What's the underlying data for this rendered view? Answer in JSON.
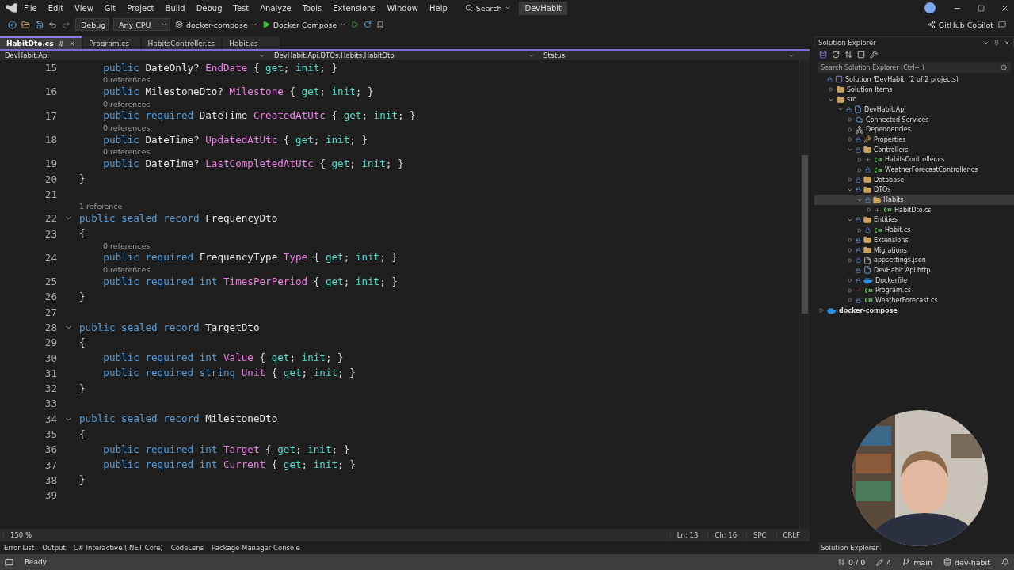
{
  "menu": {
    "items": [
      "File",
      "Edit",
      "View",
      "Git",
      "Project",
      "Build",
      "Debug",
      "Test",
      "Analyze",
      "Tools",
      "Extensions",
      "Window",
      "Help"
    ],
    "search": "Search",
    "solution_name": "DevHabit"
  },
  "toolbar": {
    "configuration": "Debug",
    "platform": "Any CPU",
    "startup_project": "docker-compose",
    "run_target": "Docker Compose"
  },
  "copilot": "GitHub Copilot",
  "tabs": [
    {
      "label": "HabitDto.cs",
      "selected": true
    },
    {
      "label": "Program.cs",
      "selected": false
    },
    {
      "label": "HabitsController.cs",
      "selected": false
    },
    {
      "label": "Habit.cs",
      "selected": false
    }
  ],
  "navbar": {
    "project": "DevHabit.Api",
    "type": "DevHabit.Api.DTOs.Habits.HabitDto",
    "member": "Status"
  },
  "code_lines": [
    {
      "num": "15",
      "tokens": [
        {
          "kind": "kw",
          "t": "    public "
        },
        {
          "kind": "type",
          "t": "DateOnly"
        },
        {
          "kind": "p",
          "t": "? "
        },
        {
          "kind": "prop",
          "t": "EndDate"
        },
        {
          "kind": "p",
          "t": " { "
        },
        {
          "kind": "acc",
          "t": "get"
        },
        {
          "kind": "p",
          "t": "; "
        },
        {
          "kind": "acc",
          "t": "init"
        },
        {
          "kind": "p",
          "t": "; }"
        }
      ]
    },
    {
      "num": "16",
      "lens": "0 references",
      "tokens": [
        {
          "kind": "kw",
          "t": "    public "
        },
        {
          "kind": "type",
          "t": "MilestoneDto"
        },
        {
          "kind": "p",
          "t": "? "
        },
        {
          "kind": "prop",
          "t": "Milestone"
        },
        {
          "kind": "p",
          "t": " { "
        },
        {
          "kind": "acc",
          "t": "get"
        },
        {
          "kind": "p",
          "t": "; "
        },
        {
          "kind": "acc",
          "t": "init"
        },
        {
          "kind": "p",
          "t": "; }"
        }
      ]
    },
    {
      "num": "17",
      "lens": "0 references",
      "tokens": [
        {
          "kind": "kw",
          "t": "    public required "
        },
        {
          "kind": "type",
          "t": "DateTime "
        },
        {
          "kind": "prop",
          "t": "CreatedAtUtc"
        },
        {
          "kind": "p",
          "t": " { "
        },
        {
          "kind": "acc",
          "t": "get"
        },
        {
          "kind": "p",
          "t": "; "
        },
        {
          "kind": "acc",
          "t": "init"
        },
        {
          "kind": "p",
          "t": "; }"
        }
      ]
    },
    {
      "num": "18",
      "lens": "0 references",
      "tokens": [
        {
          "kind": "kw",
          "t": "    public "
        },
        {
          "kind": "type",
          "t": "DateTime"
        },
        {
          "kind": "p",
          "t": "? "
        },
        {
          "kind": "prop",
          "t": "UpdatedAtUtc"
        },
        {
          "kind": "p",
          "t": " { "
        },
        {
          "kind": "acc",
          "t": "get"
        },
        {
          "kind": "p",
          "t": "; "
        },
        {
          "kind": "acc",
          "t": "init"
        },
        {
          "kind": "p",
          "t": "; }"
        }
      ]
    },
    {
      "num": "19",
      "lens": "0 references",
      "tokens": [
        {
          "kind": "kw",
          "t": "    public "
        },
        {
          "kind": "type",
          "t": "DateTime"
        },
        {
          "kind": "p",
          "t": "? "
        },
        {
          "kind": "prop",
          "t": "LastCompletedAtUtc"
        },
        {
          "kind": "p",
          "t": " { "
        },
        {
          "kind": "acc",
          "t": "get"
        },
        {
          "kind": "p",
          "t": "; "
        },
        {
          "kind": "acc",
          "t": "init"
        },
        {
          "kind": "p",
          "t": "; }"
        }
      ]
    },
    {
      "num": "20",
      "tokens": [
        {
          "kind": "p",
          "t": "}"
        }
      ]
    },
    {
      "num": "21"
    },
    {
      "num": "22",
      "lens": "1 reference",
      "fold": {
        "expanded": true
      },
      "tokens": [
        {
          "kind": "kw",
          "t": "public sealed record "
        },
        {
          "kind": "type",
          "t": "FrequencyDto"
        }
      ]
    },
    {
      "num": "23",
      "tokens": [
        {
          "kind": "p",
          "t": "{"
        }
      ]
    },
    {
      "num": "24",
      "lens": "0 references",
      "tokens": [
        {
          "kind": "kw",
          "t": "    public required "
        },
        {
          "kind": "type",
          "t": "FrequencyType "
        },
        {
          "kind": "prop",
          "t": "Type"
        },
        {
          "kind": "p",
          "t": " { "
        },
        {
          "kind": "acc",
          "t": "get"
        },
        {
          "kind": "p",
          "t": "; "
        },
        {
          "kind": "acc",
          "t": "init"
        },
        {
          "kind": "p",
          "t": "; }"
        }
      ]
    },
    {
      "num": "25",
      "lens": "0 references",
      "tokens": [
        {
          "kind": "kw",
          "t": "    public required int "
        },
        {
          "kind": "prop",
          "t": "TimesPerPeriod"
        },
        {
          "kind": "p",
          "t": " { "
        },
        {
          "kind": "acc",
          "t": "get"
        },
        {
          "kind": "p",
          "t": "; "
        },
        {
          "kind": "acc",
          "t": "init"
        },
        {
          "kind": "p",
          "t": "; }"
        }
      ]
    },
    {
      "num": "26",
      "tokens": [
        {
          "kind": "p",
          "t": "}"
        }
      ]
    },
    {
      "num": "27"
    },
    {
      "num": "28",
      "fold": {
        "expanded": true
      },
      "tokens": [
        {
          "kind": "kw",
          "t": "public sealed record "
        },
        {
          "kind": "type",
          "t": "TargetDto"
        }
      ]
    },
    {
      "num": "29",
      "tokens": [
        {
          "kind": "p",
          "t": "{"
        }
      ]
    },
    {
      "num": "30",
      "tokens": [
        {
          "kind": "kw",
          "t": "    public required int "
        },
        {
          "kind": "prop",
          "t": "Value"
        },
        {
          "kind": "p",
          "t": " { "
        },
        {
          "kind": "acc",
          "t": "get"
        },
        {
          "kind": "p",
          "t": "; "
        },
        {
          "kind": "acc",
          "t": "init"
        },
        {
          "kind": "p",
          "t": "; }"
        }
      ]
    },
    {
      "num": "31",
      "tokens": [
        {
          "kind": "kw",
          "t": "    public required string "
        },
        {
          "kind": "prop",
          "t": "Unit"
        },
        {
          "kind": "p",
          "t": " { "
        },
        {
          "kind": "acc",
          "t": "get"
        },
        {
          "kind": "p",
          "t": "; "
        },
        {
          "kind": "acc",
          "t": "init"
        },
        {
          "kind": "p",
          "t": "; }"
        }
      ]
    },
    {
      "num": "32",
      "tokens": [
        {
          "kind": "p",
          "t": "}"
        }
      ]
    },
    {
      "num": "33"
    },
    {
      "num": "34",
      "fold": {
        "expanded": true
      },
      "tokens": [
        {
          "kind": "kw",
          "t": "public sealed record "
        },
        {
          "kind": "type",
          "t": "MilestoneDto"
        }
      ]
    },
    {
      "num": "35",
      "tokens": [
        {
          "kind": "p",
          "t": "{"
        }
      ]
    },
    {
      "num": "36",
      "tokens": [
        {
          "kind": "kw",
          "t": "    public required int "
        },
        {
          "kind": "prop",
          "t": "Target"
        },
        {
          "kind": "p",
          "t": " { "
        },
        {
          "kind": "acc",
          "t": "get"
        },
        {
          "kind": "p",
          "t": "; "
        },
        {
          "kind": "acc",
          "t": "init"
        },
        {
          "kind": "p",
          "t": "; }"
        }
      ]
    },
    {
      "num": "37",
      "tokens": [
        {
          "kind": "kw",
          "t": "    public required int "
        },
        {
          "kind": "prop",
          "t": "Current"
        },
        {
          "kind": "p",
          "t": " { "
        },
        {
          "kind": "acc",
          "t": "get"
        },
        {
          "kind": "p",
          "t": "; "
        },
        {
          "kind": "acc",
          "t": "init"
        },
        {
          "kind": "p",
          "t": "; }"
        }
      ]
    },
    {
      "num": "38",
      "tokens": [
        {
          "kind": "p",
          "t": "}"
        }
      ]
    },
    {
      "num": "39"
    }
  ],
  "editor_status": {
    "zoom": "150 %",
    "line": "Ln: 13",
    "column": "Ch: 16",
    "whitespace": "SPC",
    "line_endings": "CRLF"
  },
  "solution_explorer": {
    "title": "Solution Explorer",
    "search_placeholder": "Search Solution Explorer (Ctrl+;)",
    "tree": [
      {
        "label": "Solution 'DevHabit' (2 of 2 projects)",
        "kind": "solution",
        "locked": true,
        "added": false,
        "modified": false,
        "selected": false,
        "children": [
          {
            "label": "Solution Items",
            "kind": "folder",
            "locked": false,
            "added": false,
            "modified": false,
            "expanded": false,
            "selected": false
          },
          {
            "label": "src",
            "kind": "folder",
            "locked": false,
            "added": false,
            "modified": false,
            "expanded": true,
            "selected": false,
            "children": [
              {
                "label": "DevHabit.Api",
                "kind": "project",
                "locked": true,
                "added": false,
                "modified": false,
                "expanded": true,
                "selected": false,
                "children": [
                  {
                    "label": "Connected Services",
                    "kind": "connected",
                    "locked": false,
                    "added": false,
                    "modified": false,
                    "expanded": false,
                    "selected": false
                  },
                  {
                    "label": "Dependencies",
                    "kind": "deps",
                    "locked": false,
                    "added": false,
                    "modified": false,
                    "expanded": false,
                    "selected": false
                  },
                  {
                    "label": "Properties",
                    "kind": "props",
                    "locked": true,
                    "added": false,
                    "modified": false,
                    "expanded": false,
                    "selected": false
                  },
                  {
                    "label": "Controllers",
                    "kind": "folder",
                    "locked": true,
                    "added": false,
                    "modified": false,
                    "expanded": true,
                    "selected": false,
                    "children": [
                      {
                        "label": "HabitsController.cs",
                        "kind": "csharp",
                        "locked": false,
                        "added": true,
                        "modified": false,
                        "expanded": false,
                        "selected": false
                      },
                      {
                        "label": "WeatherForecastController.cs",
                        "kind": "csharp",
                        "locked": true,
                        "added": false,
                        "modified": false,
                        "expanded": false,
                        "selected": false
                      }
                    ]
                  },
                  {
                    "label": "Database",
                    "kind": "folder",
                    "locked": true,
                    "added": false,
                    "modified": false,
                    "expanded": false,
                    "selected": false
                  },
                  {
                    "label": "DTOs",
                    "kind": "folder",
                    "locked": true,
                    "added": false,
                    "modified": false,
                    "expanded": true,
                    "selected": false,
                    "children": [
                      {
                        "label": "Habits",
                        "kind": "folder",
                        "locked": true,
                        "added": false,
                        "modified": false,
                        "expanded": true,
                        "selected": true,
                        "children": [
                          {
                            "label": "HabitDto.cs",
                            "kind": "csharp",
                            "locked": false,
                            "added": true,
                            "modified": false,
                            "expanded": false,
                            "selected": false
                          }
                        ]
                      }
                    ]
                  },
                  {
                    "label": "Entities",
                    "kind": "folder",
                    "locked": true,
                    "added": false,
                    "modified": false,
                    "expanded": true,
                    "selected": false,
                    "children": [
                      {
                        "label": "Habit.cs",
                        "kind": "csharp",
                        "locked": true,
                        "added": false,
                        "modified": false,
                        "expanded": false,
                        "selected": false
                      }
                    ]
                  },
                  {
                    "label": "Extensions",
                    "kind": "folder",
                    "locked": true,
                    "added": false,
                    "modified": false,
                    "expanded": false,
                    "selected": false
                  },
                  {
                    "label": "Migrations",
                    "kind": "folder",
                    "locked": true,
                    "added": false,
                    "modified": false,
                    "expanded": false,
                    "selected": false
                  },
                  {
                    "label": "appsettings.json",
                    "kind": "json",
                    "locked": true,
                    "added": false,
                    "modified": false,
                    "expanded": false,
                    "selected": false
                  },
                  {
                    "label": "DevHabit.Api.http",
                    "kind": "http",
                    "locked": true,
                    "added": false,
                    "modified": false,
                    "selected": false
                  },
                  {
                    "label": "Dockerfile",
                    "kind": "docker",
                    "locked": true,
                    "added": false,
                    "modified": false,
                    "expanded": false,
                    "selected": false
                  },
                  {
                    "label": "Program.cs",
                    "kind": "csharp",
                    "locked": false,
                    "added": false,
                    "modified": true,
                    "expanded": false,
                    "selected": false
                  },
                  {
                    "label": "WeatherForecast.cs",
                    "kind": "csharp",
                    "locked": true,
                    "added": false,
                    "modified": false,
                    "expanded": false,
                    "selected": false
                  }
                ]
              }
            ]
          }
        ]
      },
      {
        "label": "docker-compose",
        "kind": "docker",
        "locked": false,
        "added": false,
        "modified": false,
        "bold": true,
        "expanded": false,
        "selected": false
      }
    ],
    "bottom_tab": "Solution Explorer"
  },
  "tool_tabs": [
    "Error List",
    "Output",
    "C# Interactive (.NET Core)",
    "CodeLens",
    "Package Manager Console"
  ],
  "status_bar": {
    "state": "Ready",
    "changes": "0 / 0",
    "edits": "4",
    "branch": "main",
    "repository": "dev-habit"
  }
}
